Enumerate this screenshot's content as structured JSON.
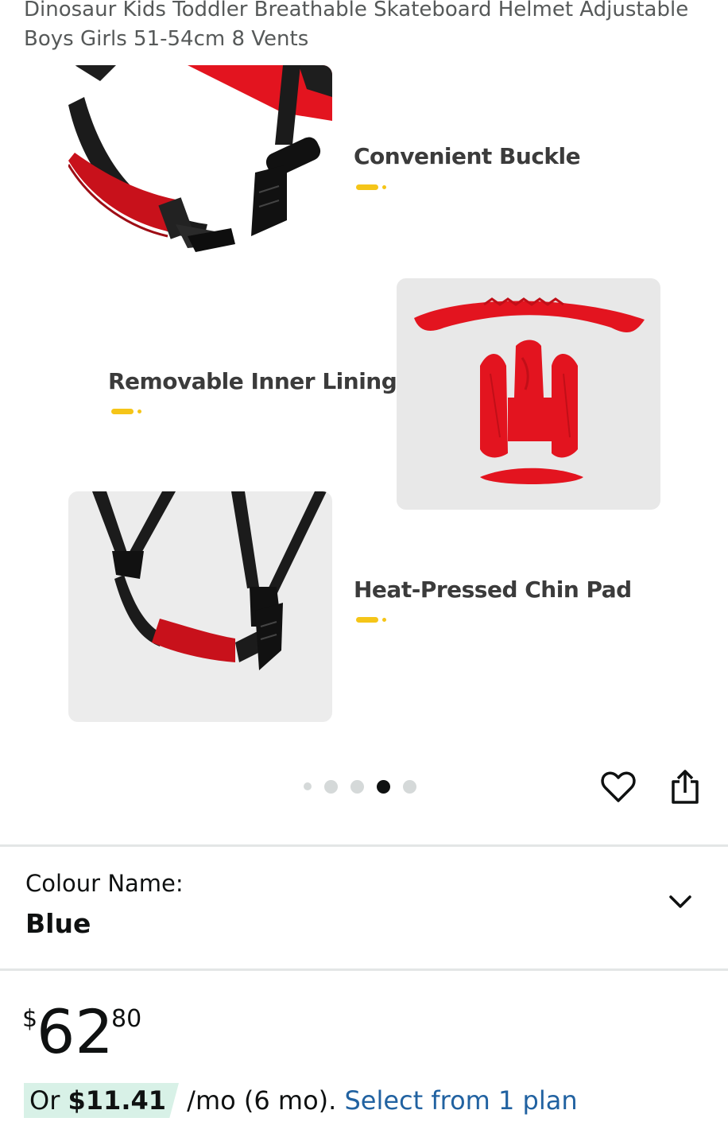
{
  "product": {
    "title": "Dinosaur Kids Toddler Breathable Skateboard Helmet Adjustable Boys Girls 51-54cm 8 Vents"
  },
  "gallery": {
    "features": [
      {
        "label": "Convenient Buckle"
      },
      {
        "label": "Removable Inner Lining"
      },
      {
        "label": "Heat-Pressed Chin Pad"
      }
    ],
    "image_count": 5,
    "active_index": 3,
    "accent_color": "#f5c518",
    "product_color": "#e3141f"
  },
  "actions": {
    "wishlist_icon": "heart-icon",
    "share_icon": "share-icon"
  },
  "variant": {
    "label": "Colour Name:",
    "value": "Blue",
    "expand_icon": "chevron-down-icon"
  },
  "price": {
    "currency": "$",
    "whole": "62",
    "fraction": "80"
  },
  "installment": {
    "prefix": "Or ",
    "amount": "$11.41",
    "suffix": " /mo (6 mo). ",
    "link": "Select from 1 plan",
    "highlight_color": "#d8f1e7",
    "link_color": "#2162a1"
  }
}
